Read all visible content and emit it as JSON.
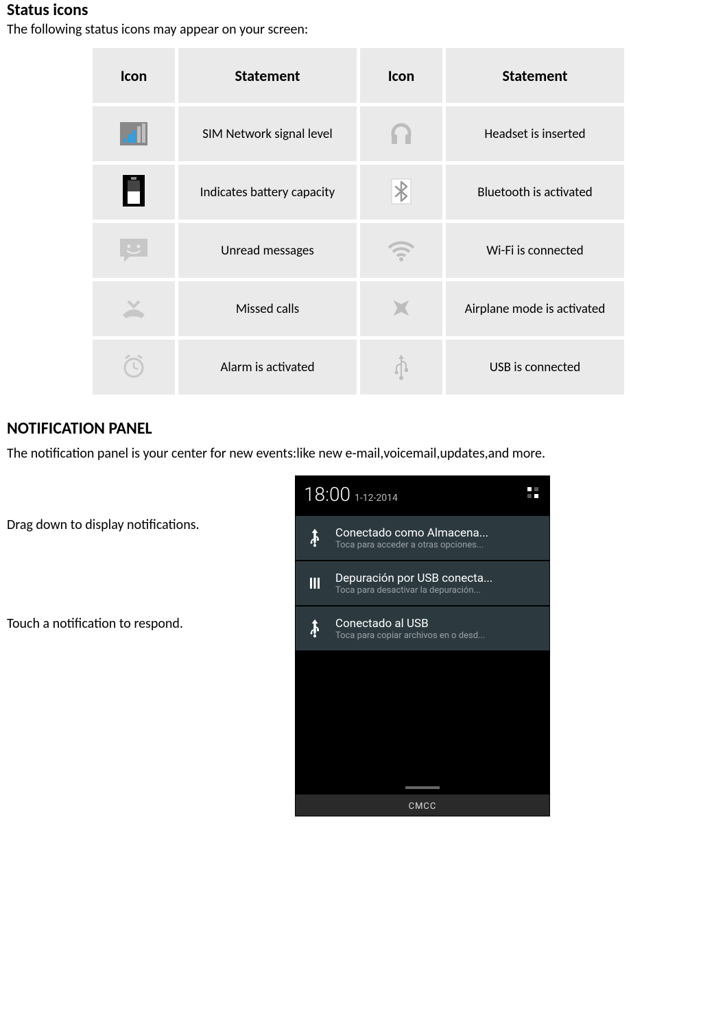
{
  "status_icons": {
    "title": "Status icons",
    "intro": "The following status icons may appear on your screen:",
    "headers": {
      "icon": "Icon",
      "statement": "Statement"
    },
    "rows": [
      {
        "left": "SIM Network signal level",
        "right": "Headset is inserted"
      },
      {
        "left": "Indicates battery capacity",
        "right": "Bluetooth is activated"
      },
      {
        "left": "Unread messages",
        "right": "Wi-Fi is connected"
      },
      {
        "left": "Missed calls",
        "right": "Airplane mode is activated"
      },
      {
        "left": "Alarm is activated",
        "right": "USB is connected"
      }
    ]
  },
  "notification_panel": {
    "title": "NOTIFICATION PANEL",
    "intro": "The notification panel is your center for new events:like new e-mail,voicemail,updates,and more.",
    "instruction_drag": "Drag down to display notifications.",
    "instruction_touch": "Touch a notification to respond.",
    "time": "18:00",
    "date": "1-12-2014",
    "items": [
      {
        "title": "Conectado como Almacena...",
        "sub": "Toca para acceder a otras opciones..."
      },
      {
        "title": "Depuración por USB conecta...",
        "sub": "Toca para desactivar la depuración..."
      },
      {
        "title": "Conectado al USB",
        "sub": "Toca para copiar archivos en o desd..."
      }
    ],
    "carrier": "CMCC"
  }
}
